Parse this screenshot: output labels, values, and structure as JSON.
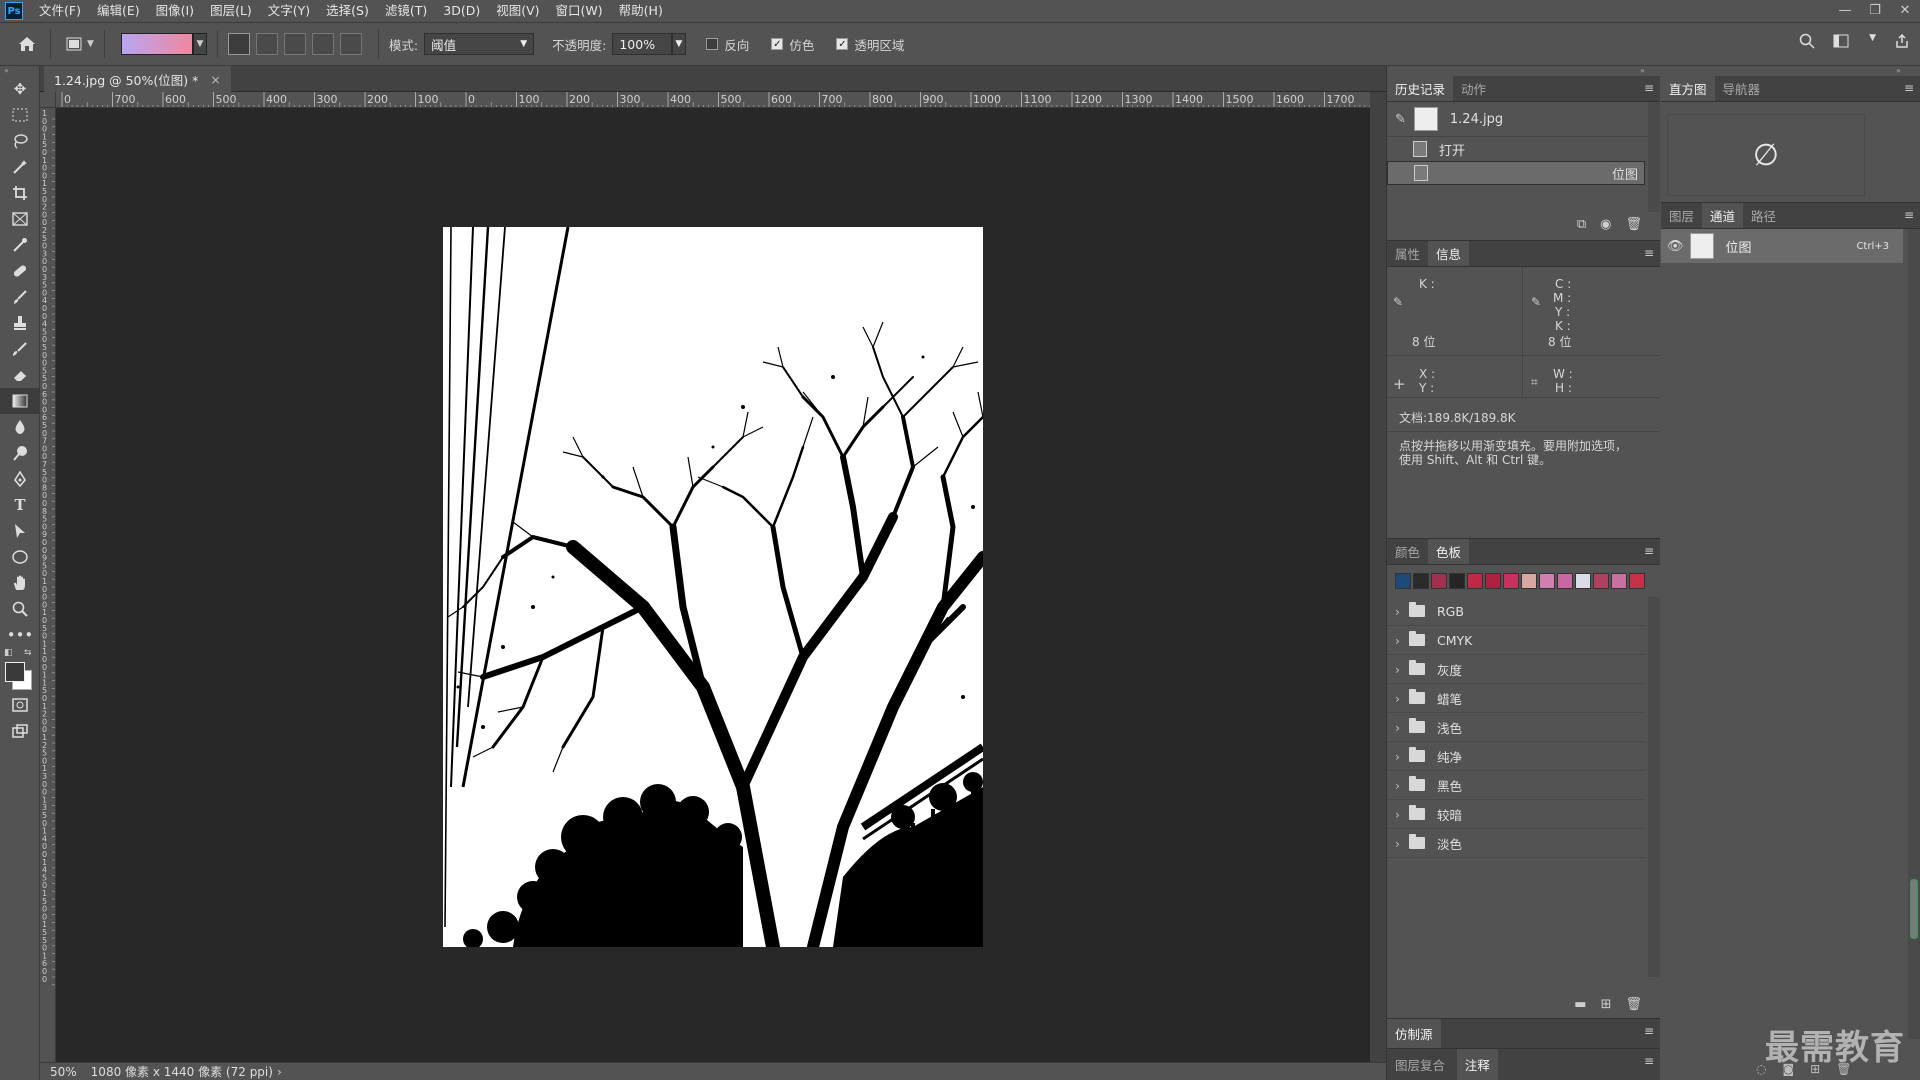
{
  "menubar": {
    "logo": "Ps",
    "items": [
      "文件(F)",
      "编辑(E)",
      "图像(I)",
      "图层(L)",
      "文字(Y)",
      "选择(S)",
      "滤镜(T)",
      "3D(D)",
      "视图(V)",
      "窗口(W)",
      "帮助(H)"
    ]
  },
  "options": {
    "mode_label": "模式:",
    "mode_value": "阈值",
    "opacity_label": "不透明度:",
    "opacity_value": "100%",
    "reverse_label": "反向",
    "dither_label": "仿色",
    "transparency_label": "透明区域",
    "reverse_checked": false,
    "dither_checked": true,
    "transparency_checked": true,
    "gradient_colors": [
      "#b8a6f0",
      "#f087a0"
    ]
  },
  "document": {
    "tab_title": "1.24.jpg @ 50%(位图) *",
    "close": "×",
    "ruler_h_labels": [
      "0",
      "700",
      "600",
      "500",
      "400",
      "300",
      "200",
      "100",
      "0",
      "100",
      "200",
      "300",
      "400",
      "500",
      "600",
      "700",
      "800",
      "900",
      "1000",
      "1100",
      "1200",
      "1300",
      "1400",
      "1500",
      "1600",
      "1700",
      "180"
    ],
    "ruler_v_labels": [
      "1",
      "0",
      "0",
      "1",
      "5",
      "0",
      "1",
      "0",
      "0",
      "1",
      "5",
      "0",
      "2",
      "0",
      "0",
      "2",
      "5",
      "0",
      "3",
      "0",
      "0",
      "3",
      "5",
      "0",
      "4",
      "0",
      "0",
      "4",
      "5",
      "0",
      "5",
      "0",
      "0",
      "5",
      "5",
      "0",
      "6",
      "0",
      "0",
      "6",
      "5",
      "0",
      "7",
      "0",
      "0",
      "7",
      "5",
      "0",
      "8",
      "0",
      "0",
      "8",
      "5",
      "0",
      "9",
      "0",
      "0",
      "9",
      "5",
      "0",
      "1",
      "0",
      "0",
      "0",
      "1",
      "0",
      "5",
      "0",
      "1",
      "1",
      "0",
      "0",
      "1",
      "1",
      "5",
      "0",
      "1",
      "2",
      "0",
      "0",
      "1",
      "2",
      "5",
      "0",
      "1",
      "3",
      "0",
      "0",
      "1",
      "3",
      "5",
      "0",
      "1",
      "4",
      "0",
      "0",
      "1",
      "4",
      "5",
      "0",
      "1",
      "5",
      "0",
      "0",
      "1",
      "5",
      "5",
      "0",
      "1",
      "6",
      "0",
      "0"
    ]
  },
  "status": {
    "zoom": "50%",
    "info": "1080 像素 x 1440 像素 (72 ppi)"
  },
  "history": {
    "tabs": [
      "历史记录",
      "动作"
    ],
    "snapshot": "1.24.jpg",
    "items": [
      "打开",
      "位图"
    ],
    "selected": 1
  },
  "info_panel": {
    "tabs": [
      "属性",
      "信息"
    ],
    "k": "K :",
    "bits": "8 位",
    "cmyk": [
      "C :",
      "M :",
      "Y :",
      "K :"
    ],
    "bits2": "8 位",
    "x": "X :",
    "y": "Y :",
    "w": "W :",
    "h": "H :",
    "doc": "文档:189.8K/189.8K",
    "hint": "点按并拖移以用渐变填充。要用附加选项，使用 Shift、Alt 和 Ctrl 键。"
  },
  "swatches_panel": {
    "tabs": [
      "颜色",
      "色板"
    ],
    "colors": [
      "#1e4a7a",
      "#2a2a2a",
      "#a03050",
      "#252525",
      "#c02848",
      "#b02040",
      "#c83060",
      "#d8a8a0",
      "#d080b0",
      "#c868a0",
      "#d8dde8",
      "#b04060",
      "#c870a0",
      "#c83048"
    ],
    "groups": [
      "RGB",
      "CMYK",
      "灰度",
      "蜡笔",
      "浅色",
      "纯净",
      "黑色",
      "较暗",
      "淡色"
    ]
  },
  "clone_panel": {
    "title": "仿制源"
  },
  "comp_panel": {
    "tabs": [
      "图层复合",
      "注释"
    ]
  },
  "histogram": {
    "tabs": [
      "直方图",
      "导航器"
    ],
    "empty": "∅"
  },
  "channels": {
    "tabs": [
      "图层",
      "通道",
      "路径"
    ],
    "name": "位图",
    "shortcut": "Ctrl+3"
  },
  "watermark": "最需教育"
}
